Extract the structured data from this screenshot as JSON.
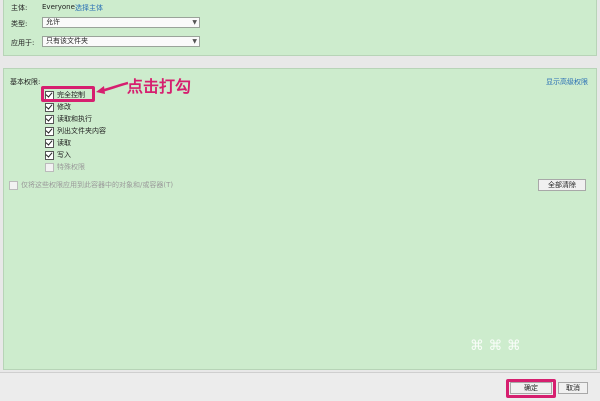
{
  "principal": {
    "label": "主体:",
    "value": "Everyone",
    "link": "选择主体"
  },
  "type": {
    "label": "类型:",
    "selected": "允许"
  },
  "applies_to": {
    "label": "应用于:",
    "selected": "只有该文件夹"
  },
  "basic_permissions": {
    "heading": "基本权限:",
    "show_advanced_link": "显示高级权限",
    "items": [
      {
        "label": "完全控制",
        "checked": true,
        "disabled": false
      },
      {
        "label": "修改",
        "checked": true,
        "disabled": false
      },
      {
        "label": "读取和执行",
        "checked": true,
        "disabled": false
      },
      {
        "label": "列出文件夹内容",
        "checked": true,
        "disabled": false
      },
      {
        "label": "读取",
        "checked": true,
        "disabled": false
      },
      {
        "label": "写入",
        "checked": true,
        "disabled": false
      },
      {
        "label": "特殊权限",
        "checked": false,
        "disabled": true
      }
    ],
    "apply_only_container": "仅将这些权限应用到此容器中的对象和/或容器(T)",
    "clear_all_button": "全部清除"
  },
  "annotation": {
    "text": "点击打勾",
    "color": "#d61f6f"
  },
  "footer": {
    "ok_button": "确定",
    "cancel_button": "取消"
  },
  "watermark": "⌘ ⌘ ⌘",
  "colors": {
    "panel": "#cdeccd",
    "highlight": "#d61f6f",
    "link": "#2a6fb5"
  }
}
